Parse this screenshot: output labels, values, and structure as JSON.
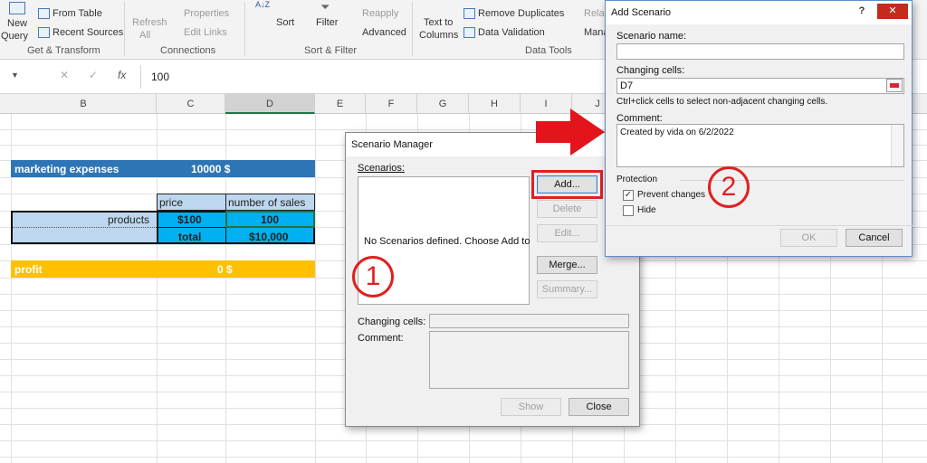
{
  "ribbon": {
    "new_query": "New",
    "new_query2": "Query",
    "from_table": "From Table",
    "recent_sources": "Recent Sources",
    "get_transform": "Get & Transform",
    "refresh": "Refresh",
    "refresh_all": "All",
    "properties": "Properties",
    "edit_links": "Edit Links",
    "connections": "Connections",
    "sort": "Sort",
    "filter": "Filter",
    "reapply": "Reapply",
    "advanced": "Advanced",
    "sort_filter": "Sort & Filter",
    "text_to": "Text to",
    "columns": "Columns",
    "remove_duplicates": "Remove Duplicates",
    "data_validation": "Data Validation",
    "relationships": "Relati",
    "manage": "Mana",
    "data_tools": "Data Tools"
  },
  "formula_bar": {
    "value": "100",
    "cancel": "✕",
    "enter": "✓",
    "fx": "fx"
  },
  "columns": [
    "B",
    "C",
    "D",
    "E",
    "F",
    "G",
    "H",
    "I",
    "J"
  ],
  "sheet": {
    "marketing_label": "marketing expenses",
    "marketing_value": "10000 $",
    "price_header": "price",
    "sales_header": "number of sales",
    "products_label": "products",
    "price_value": "$100",
    "sales_value": "100",
    "total_label": "total",
    "total_value": "$10,000",
    "profit_label": "profit",
    "profit_value": "0 $"
  },
  "scenario_manager": {
    "title": "Scenario Manager",
    "scenarios_label": "Scenarios:",
    "empty_text": "No Scenarios defined. Choose Add to",
    "add": "Add...",
    "delete": "Delete",
    "edit": "Edit...",
    "merge": "Merge...",
    "summary": "Summary...",
    "changing_cells": "Changing cells:",
    "comment": "Comment:",
    "show": "Show",
    "close": "Close"
  },
  "add_scenario": {
    "title": "Add Scenario",
    "help": "?",
    "close_x": "✕",
    "name_label": "Scenario name:",
    "name_value": "",
    "cells_label": "Changing cells:",
    "cells_value": "D7",
    "hint": "Ctrl+click cells to select non-adjacent changing cells.",
    "comment_label": "Comment:",
    "comment_value": "Created by vida on 6/2/2022",
    "protection": "Protection",
    "prevent_changes": "Prevent changes",
    "prevent_checked": true,
    "hide": "Hide",
    "hide_checked": false,
    "ok": "OK",
    "cancel": "Cancel"
  },
  "annotations": {
    "step1": "1",
    "step2": "2",
    "arrow_color": "#e3141b",
    "circle_color": "#e02020"
  },
  "colors": {
    "header_blue": "#2e75b6",
    "light_blue": "#bdd7ee",
    "cyan": "#00b0f0",
    "profit_orange": "#ffc000"
  }
}
